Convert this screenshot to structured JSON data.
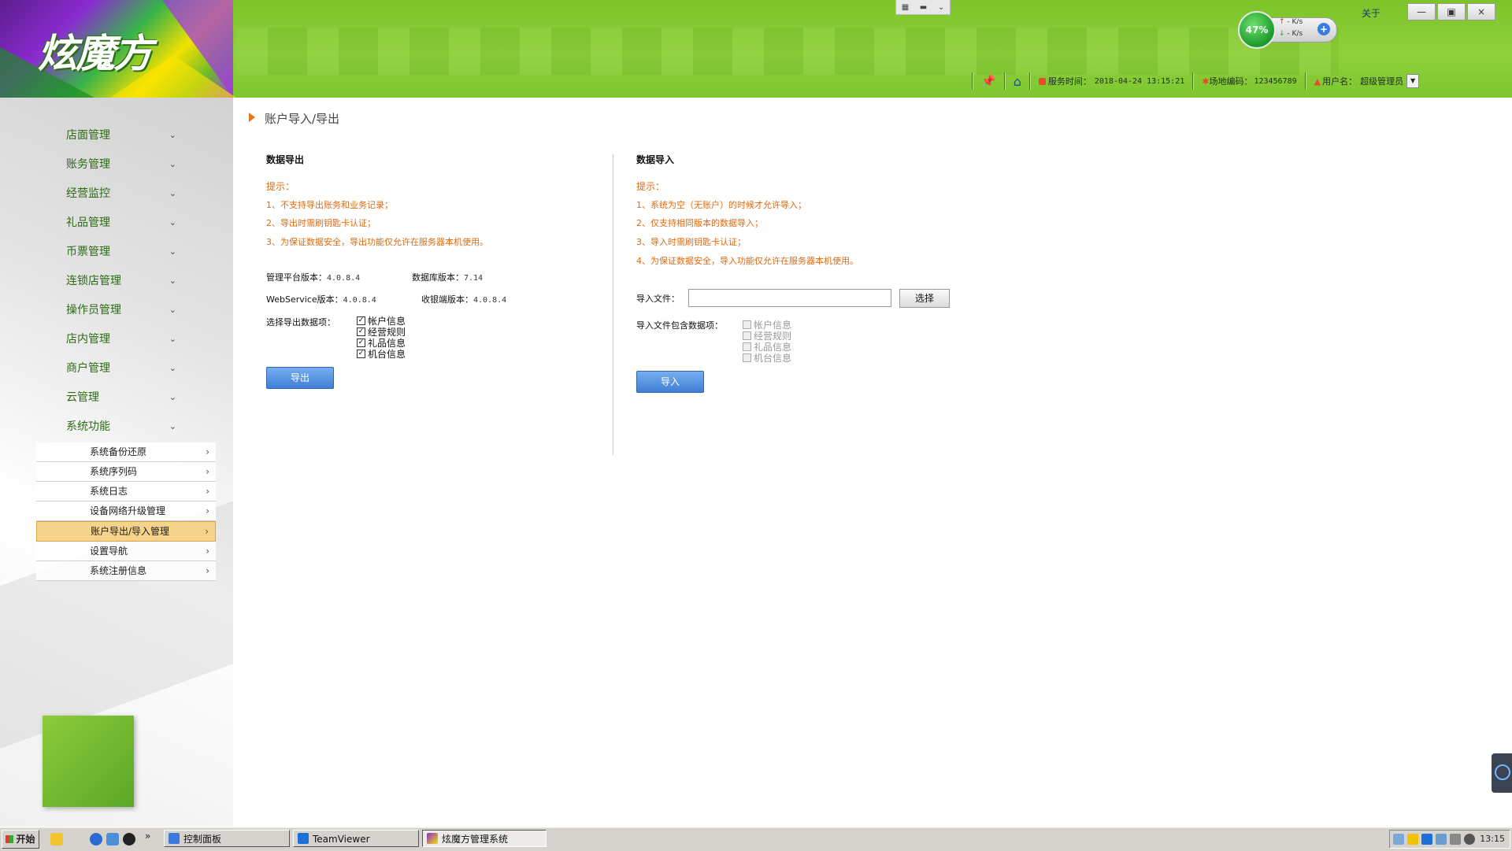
{
  "header": {
    "logo_text": "炫魔方",
    "about_label": "关于",
    "window_controls": {
      "minimize": "—",
      "restore": "▣",
      "close": "×"
    },
    "net_widget": {
      "percent": "47%",
      "up_speed": "- K/s",
      "down_speed": "- K/s"
    },
    "server_time_label": "服务时间：",
    "server_time_value": "2018-04-24 13:15:21",
    "site_code_label": "场地编码：",
    "site_code_value": "123456789",
    "user_label": "用户名：",
    "user_value": "超级管理员",
    "colors": {
      "header_green": "#8ed03a",
      "accent_orange": "#e06a10"
    }
  },
  "sidebar": {
    "items": [
      {
        "label": "店面管理"
      },
      {
        "label": "账务管理"
      },
      {
        "label": "经营监控"
      },
      {
        "label": "礼品管理"
      },
      {
        "label": "币票管理"
      },
      {
        "label": "连锁店管理"
      },
      {
        "label": "操作员管理"
      },
      {
        "label": "店内管理"
      },
      {
        "label": "商户管理"
      },
      {
        "label": "云管理"
      },
      {
        "label": "系统功能"
      }
    ],
    "subitems": [
      {
        "label": "系统备份还原"
      },
      {
        "label": "系统序列码"
      },
      {
        "label": "系统日志"
      },
      {
        "label": "设备网络升级管理"
      },
      {
        "label": "账户导出/导入管理"
      },
      {
        "label": "设置导航"
      },
      {
        "label": "系统注册信息"
      }
    ]
  },
  "main": {
    "breadcrumb": "账户导入/导出",
    "export": {
      "title": "数据导出",
      "tip_head": "提示：",
      "tips": [
        "1、不支持导出账务和业务记录；",
        "2、导出时需刷钥匙卡认证；",
        "3、为保证数据安全，导出功能仅允许在服务器本机使用。"
      ],
      "platform_version_label": "管理平台版本：",
      "platform_version_value": "4.0.8.4",
      "db_version_label": "数据库版本：",
      "db_version_value": "7.14",
      "ws_version_label": "WebService版本：",
      "ws_version_value": "4.0.8.4",
      "cashier_version_label": "收银端版本：",
      "cashier_version_value": "4.0.8.4",
      "select_label": "选择导出数据项：",
      "options": [
        {
          "label": "帐户信息",
          "checked": true
        },
        {
          "label": "经营规则",
          "checked": true
        },
        {
          "label": "礼品信息",
          "checked": true
        },
        {
          "label": "机台信息",
          "checked": true
        }
      ],
      "button": "导出"
    },
    "import": {
      "title": "数据导入",
      "tip_head": "提示：",
      "tips": [
        "1、系统为空（无账户）的时候才允许导入；",
        "2、仅支持相同版本的数据导入；",
        "3、导入时需刷钥匙卡认证；",
        "4、为保证数据安全，导入功能仅允许在服务器本机使用。"
      ],
      "file_label": "导入文件：",
      "file_value": "",
      "choose_button": "选择",
      "contains_label": "导入文件包含数据项：",
      "options": [
        {
          "label": "帐户信息",
          "checked": false
        },
        {
          "label": "经营规则",
          "checked": false
        },
        {
          "label": "礼品信息",
          "checked": false
        },
        {
          "label": "机台信息",
          "checked": false
        }
      ],
      "button": "导入"
    }
  },
  "taskbar": {
    "start_label": "开始",
    "tasks": [
      {
        "label": "控制面板"
      },
      {
        "label": "TeamViewer"
      },
      {
        "label": "炫魔方管理系统"
      }
    ],
    "clock": "13:15"
  }
}
